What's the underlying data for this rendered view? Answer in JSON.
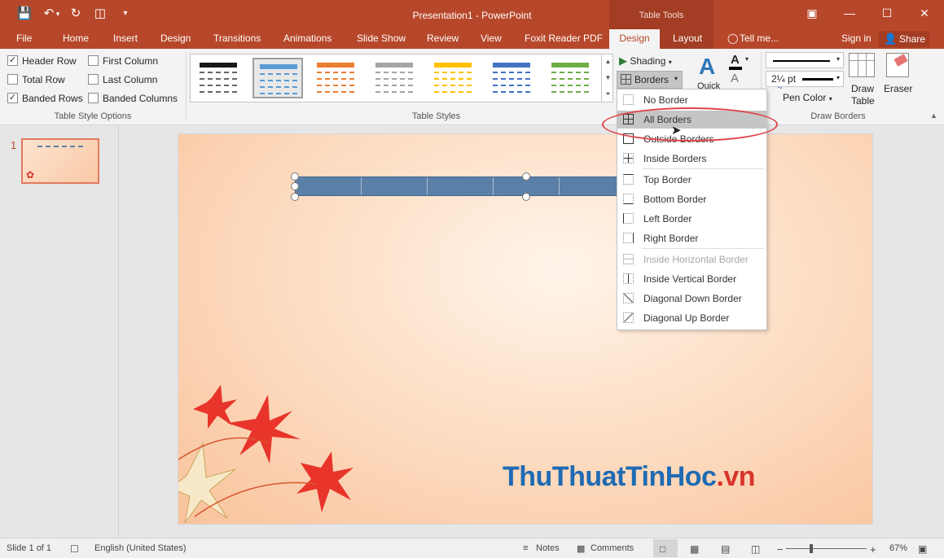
{
  "window": {
    "title": "Presentation1 - PowerPoint",
    "contextual_group": "Table Tools",
    "controls": [
      "restore-ribbon",
      "minimize",
      "maximize",
      "close"
    ]
  },
  "tabs": [
    "File",
    "Home",
    "Insert",
    "Design",
    "Transitions",
    "Animations",
    "Slide Show",
    "Review",
    "View",
    "Foxit Reader PDF",
    "Design",
    "Layout"
  ],
  "tell_me": "Tell me...",
  "account": {
    "sign_in": "Sign in",
    "share": "Share"
  },
  "ribbon": {
    "table_style_options": {
      "label": "Table Style Options",
      "options": [
        {
          "label": "Header Row",
          "checked": true
        },
        {
          "label": "First Column",
          "checked": false
        },
        {
          "label": "Total Row",
          "checked": false
        },
        {
          "label": "Last Column",
          "checked": false
        },
        {
          "label": "Banded Rows",
          "checked": true
        },
        {
          "label": "Banded Columns",
          "checked": false
        }
      ]
    },
    "table_styles": {
      "label": "Table Styles",
      "thumb_colors": [
        "#1a1a1a",
        "#5b9bd5",
        "#ed7d31",
        "#a5a5a5",
        "#ffc000",
        "#4472c4",
        "#70ad47"
      ],
      "selected_index": 1
    },
    "shading": "Shading",
    "borders": "Borders",
    "quick": "Quick",
    "draw_borders": {
      "label": "Draw Borders",
      "pen_weight": "2¼ pt",
      "pen_color": "Pen Color",
      "draw_table": [
        "Draw",
        "Table"
      ],
      "eraser": "Eraser"
    }
  },
  "slides": {
    "number": "1"
  },
  "borders_menu": {
    "items": [
      {
        "label": "No Border",
        "state": "normal"
      },
      {
        "label": "All Borders",
        "state": "hot"
      },
      {
        "label": "Outside Borders",
        "state": "normal"
      },
      {
        "label": "Inside Borders",
        "state": "normal"
      },
      {
        "label": "Top Border",
        "state": "normal"
      },
      {
        "label": "Bottom Border",
        "state": "normal"
      },
      {
        "label": "Left Border",
        "state": "normal"
      },
      {
        "label": "Right Border",
        "state": "normal"
      },
      {
        "label": "Inside Horizontal Border",
        "state": "disabled"
      },
      {
        "label": "Inside Vertical Border",
        "state": "normal"
      },
      {
        "label": "Diagonal Down Border",
        "state": "normal"
      },
      {
        "label": "Diagonal Up Border",
        "state": "normal"
      }
    ]
  },
  "watermark": {
    "main": "ThuThuatTinHoc",
    "suffix": ".vn"
  },
  "status": {
    "slide": "Slide 1 of 1",
    "language": "English (United States)",
    "notes": "Notes",
    "comments": "Comments",
    "zoom": "67%",
    "zoom_value": 0.67
  },
  "colors": {
    "accent": "#b7472a",
    "table_fill": "#5b80a8",
    "highlight_ring": "#e0454a"
  }
}
